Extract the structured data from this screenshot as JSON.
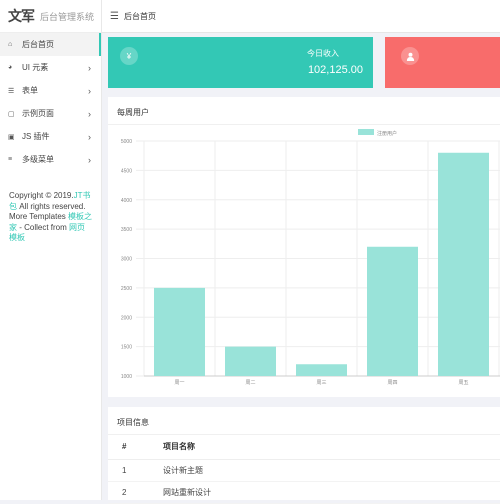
{
  "app": {
    "logo_mark": "文军",
    "title": "后台管理系统"
  },
  "topbar": {
    "title": "后台首页"
  },
  "sidebar": {
    "items": [
      {
        "icon": "home-icon",
        "glyph": "⌂",
        "label": "后台首页",
        "arrow": ""
      },
      {
        "icon": "palette-icon",
        "glyph": "◕",
        "label": "UI 元素",
        "arrow": "›"
      },
      {
        "icon": "table-icon",
        "glyph": "☰",
        "label": "表单",
        "arrow": "›"
      },
      {
        "icon": "file-icon",
        "glyph": "▢",
        "label": "示例页面",
        "arrow": "›"
      },
      {
        "icon": "plugin-icon",
        "glyph": "▣",
        "label": "JS 插件",
        "arrow": "›"
      },
      {
        "icon": "list-icon",
        "glyph": "≡",
        "label": "多级菜单",
        "arrow": "›"
      }
    ],
    "copyright_pre": "Copyright © 2019.",
    "copyright_link1": "JT书包",
    "copyright_mid": " All rights reserved. More Templates ",
    "copyright_link2": "模板之家",
    "copyright_mid2": " - Collect from ",
    "copyright_link3": "网页模板"
  },
  "stats": {
    "income": {
      "icon": "yen-icon",
      "glyph": "¥",
      "label": "今日收入",
      "value": "102,125.00"
    },
    "users": {
      "icon": "user-icon",
      "glyph": "👤"
    }
  },
  "chart_panel": {
    "title": "每周用户"
  },
  "chart_data": {
    "type": "bar",
    "categories": [
      "周一",
      "周二",
      "周三",
      "周四",
      "周五"
    ],
    "series": [
      {
        "name": "注册用户",
        "values": [
          2500,
          1500,
          1200,
          3200,
          4800
        ]
      }
    ],
    "ylim": [
      1000,
      5000
    ],
    "yticks": [
      1000,
      1500,
      2000,
      2500,
      3000,
      3500,
      4000,
      4500,
      5000
    ],
    "bar_color": "#99e3d9",
    "grid": true,
    "legend": "top-center"
  },
  "projects": {
    "title": "项目信息",
    "headers": [
      "#",
      "项目名称"
    ],
    "rows": [
      [
        "1",
        "设计新主题"
      ],
      [
        "2",
        "网站重新设计"
      ]
    ]
  },
  "colors": {
    "accent": "#33c8b5",
    "danger": "#f86c6b"
  }
}
